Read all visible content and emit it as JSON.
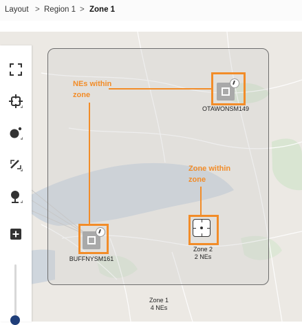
{
  "breadcrumb": {
    "items": [
      "Layout",
      "Region 1",
      "Zone 1"
    ],
    "separator": ">"
  },
  "toolbar": {
    "tools": [
      {
        "name": "fit-screen-icon",
        "interactable": true
      },
      {
        "name": "target-select-icon",
        "interactable": true
      },
      {
        "name": "add-node-icon",
        "interactable": true
      },
      {
        "name": "draw-link-icon",
        "interactable": true
      },
      {
        "name": "location-icon",
        "interactable": true
      },
      {
        "name": "plus-icon",
        "interactable": true
      }
    ],
    "zoom_level_fraction": 0.95
  },
  "map": {
    "nodes": [
      {
        "label": "OTAWONSM149"
      },
      {
        "label": "BUFFNYSM161"
      }
    ],
    "inner_zone": {
      "name": "Zone 2",
      "count": "2 NEs"
    },
    "outer_zone": {
      "name": "Zone 1",
      "count": "4 NEs"
    }
  },
  "callouts": {
    "nes_within_zone": [
      "NEs within",
      "zone"
    ],
    "zone_within_zone": [
      "Zone within",
      "zone"
    ]
  },
  "colors": {
    "accent": "#f28c28",
    "zoom_handle": "#1f3e79",
    "ne_icon": "#a9a9a9"
  }
}
